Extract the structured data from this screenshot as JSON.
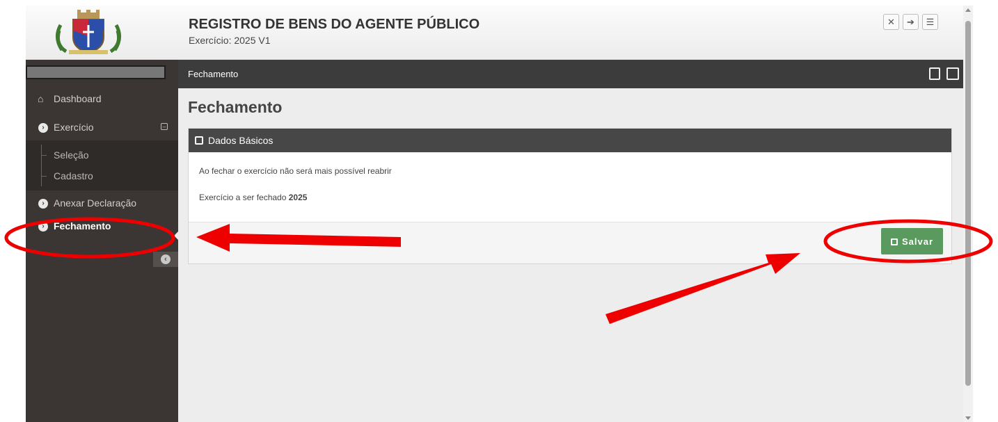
{
  "header": {
    "title": "REGISTRO DE BENS DO AGENTE PÚBLICO",
    "subtitle": "Exercício: 2025 V1",
    "icons": [
      "expand-icon",
      "logout-icon",
      "menu-icon"
    ],
    "logo": "municipal-coat-of-arms"
  },
  "sidebar": {
    "items": [
      {
        "label": "Dashboard",
        "icon": "home-icon"
      },
      {
        "label": "Exercício",
        "icon": "chevron-circle-icon",
        "expanded": true,
        "children": [
          {
            "label": "Seleção"
          },
          {
            "label": "Cadastro"
          }
        ]
      },
      {
        "label": "Anexar Declaração",
        "icon": "chevron-circle-icon"
      },
      {
        "label": "Fechamento",
        "icon": "chevron-circle-icon",
        "active": true
      }
    ]
  },
  "topbar": {
    "title": "Fechamento",
    "icons": [
      "pdf-icon",
      "film-icon"
    ]
  },
  "main": {
    "page_title": "Fechamento",
    "panel": {
      "title": "Dados Básicos",
      "warning": "Ao fechar o exercício não será mais possível reabrir",
      "year_label": "Exercício a ser fechado",
      "year_value": "2025",
      "save_label": "Salvar"
    }
  },
  "colors": {
    "sidebar_bg": "#3b3633",
    "topbar_bg": "#3c3c3c",
    "save_button": "#5b9a5e",
    "annotation": "#ee0000"
  }
}
